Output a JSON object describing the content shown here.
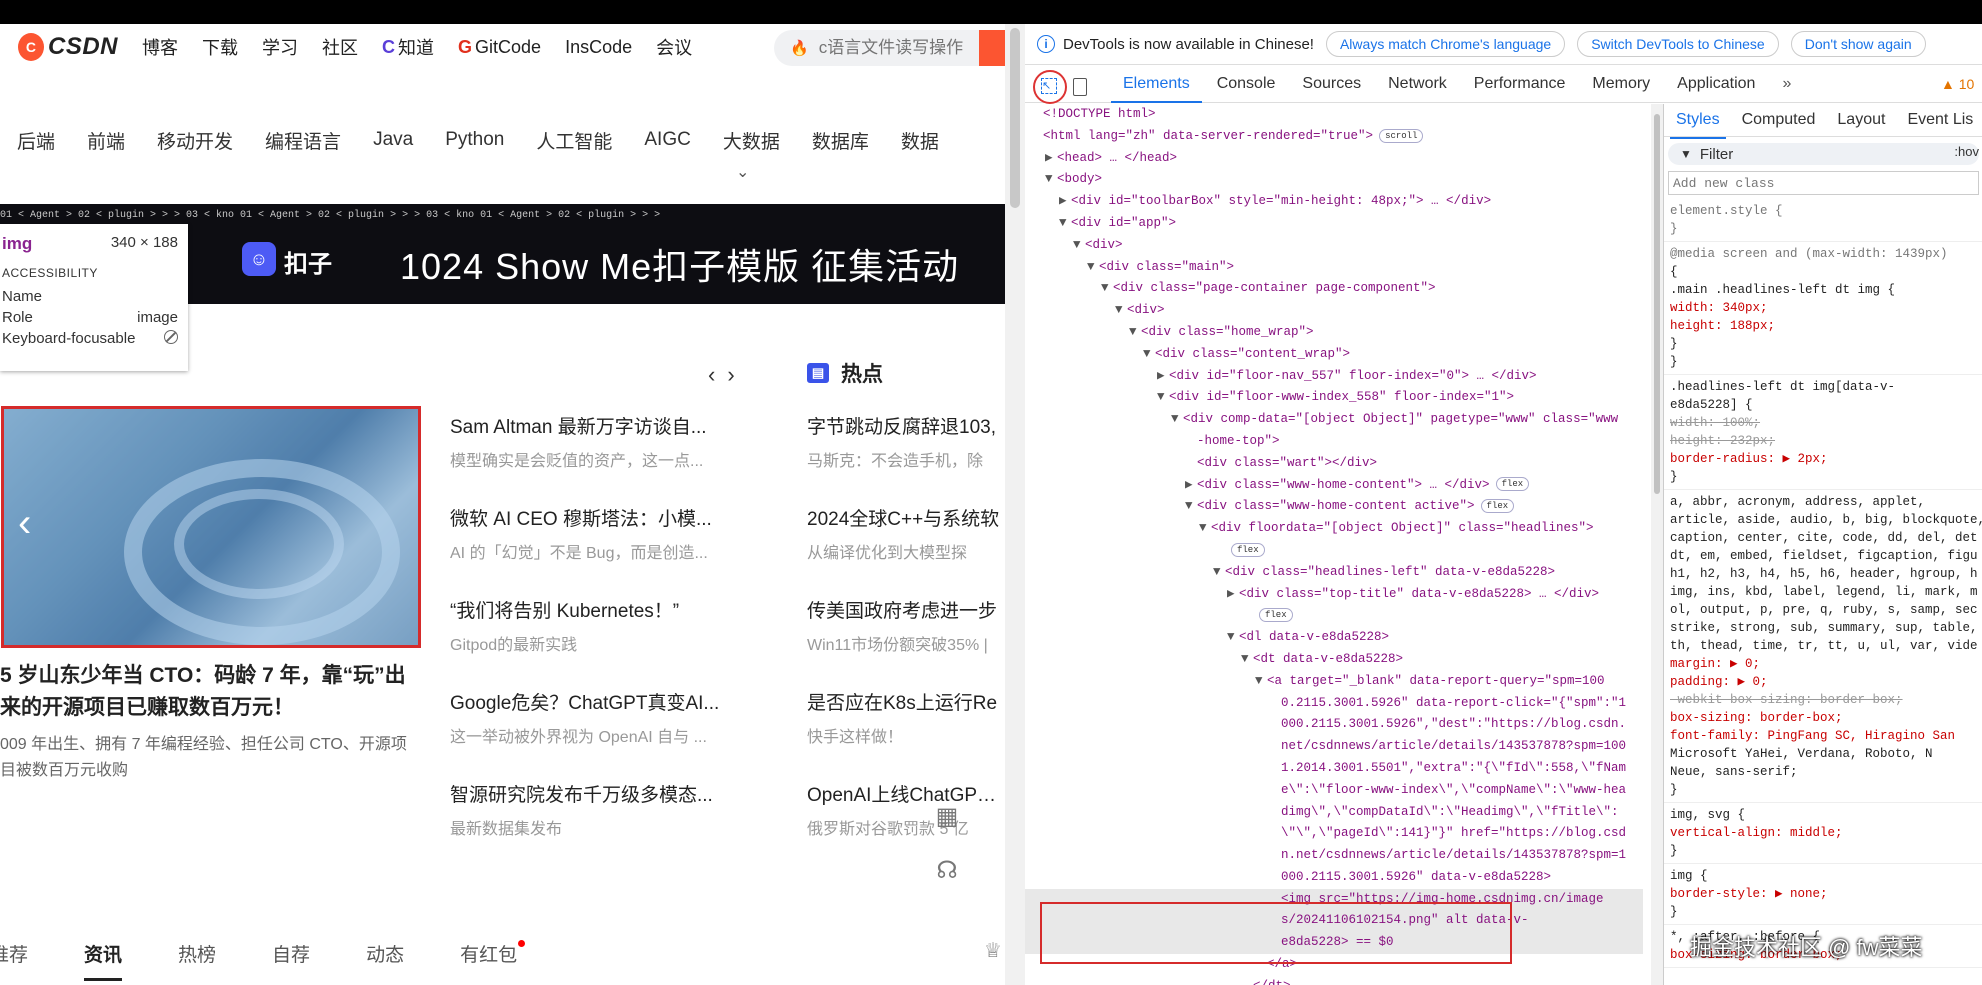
{
  "csdn": {
    "logo": "CSDN",
    "nav": [
      "博客",
      "下载",
      "学习",
      "社区",
      "知道",
      "GitCode",
      "InsCode",
      "会议"
    ],
    "search_placeholder": "c语言文件读写操作",
    "categories": [
      "后端",
      "前端",
      "移动开发",
      "编程语言",
      "Java",
      "Python",
      "人工智能",
      "AIGC",
      "大数据",
      "数据库",
      "数据"
    ],
    "banner": {
      "strip": "01 < Agent >     02 < plugin >     > >     03 < kno  01 < Agent >     02 < plugin >     > >     03 < kno  01 < Agent >     02 < plugin >     > >",
      "brand": "扣子",
      "title": "1024 Show Me扣子模版 征集活动"
    },
    "tooltip": {
      "tag": "img",
      "size": "340 × 188",
      "section": "ACCESSIBILITY",
      "rows": [
        {
          "label": "Name",
          "value": ""
        },
        {
          "label": "Role",
          "value": "image"
        },
        {
          "label": "Keyboard-focusable",
          "value": ""
        }
      ]
    },
    "hot_title": "热点",
    "feature": {
      "title": "5 岁山东少年当 CTO：码龄 7 年，靠“玩”出来的开源项目已赚取数百万元！",
      "desc": "009 年出生、拥有 7 年编程经验、担任公司 CTO、开源项目被数百万元收购"
    },
    "news_mid": [
      {
        "title": "Sam Altman 最新万字访谈自...",
        "sub": "模型确实是会贬值的资产，这一点..."
      },
      {
        "title": "微软 AI CEO 穆斯塔法：小模...",
        "sub": "AI 的「幻觉」不是 Bug，而是创造..."
      },
      {
        "title": "“我们将告别 Kubernetes！”",
        "sub": "Gitpod的最新实践"
      },
      {
        "title": "Google危矣？ChatGPT真变AI...",
        "sub": "这一举动被外界视为 OpenAI 自与 ..."
      },
      {
        "title": "智源研究院发布千万级多模态...",
        "sub": "最新数据集发布"
      }
    ],
    "news_hot": [
      {
        "title": "字节跳动反腐辞退103,",
        "sub": "马斯克：不会造手机，除"
      },
      {
        "title": "2024全球C++与系统软",
        "sub": "从编译优化到大模型探"
      },
      {
        "title": "传美国政府考虑进一步",
        "sub": "Win11市场份额突破35% |"
      },
      {
        "title": "是否应在K8s上运行Re",
        "sub": "快手这样做！"
      },
      {
        "title": "OpenAI上线ChatGPT打",
        "sub": "俄罗斯对谷歌罚款 5 亿"
      }
    ],
    "bottom_tabs": [
      "推荐",
      "资讯",
      "热榜",
      "自荐",
      "动态",
      "有红包"
    ]
  },
  "devtools": {
    "info": "DevTools is now available in Chinese!",
    "info_buttons": [
      "Always match Chrome's language",
      "Switch DevTools to Chinese",
      "Don't show again"
    ],
    "tabs": [
      "Elements",
      "Console",
      "Sources",
      "Network",
      "Performance",
      "Memory",
      "Application"
    ],
    "more": "»",
    "warnings": "▲ 10",
    "styles_tabs": [
      "Styles",
      "Computed",
      "Layout",
      "Event Lis"
    ],
    "filter_placeholder": "Filter",
    "hov": ":hov",
    "add_class_placeholder": "Add new class",
    "dom_lines": [
      {
        "indent": 0,
        "tri": "",
        "html": "<!DOCTYPE html>"
      },
      {
        "indent": 0,
        "tri": "",
        "html": "<html lang=\"zh\" data-server-rendered=\"true\">",
        "badge": "scroll"
      },
      {
        "indent": 1,
        "tri": "▶",
        "html": "<head> … </head>"
      },
      {
        "indent": 1,
        "tri": "▼",
        "html": "<body>"
      },
      {
        "indent": 2,
        "tri": "▶",
        "html": "<div id=\"toolbarBox\" style=\"min-height: 48px;\"> … </div>"
      },
      {
        "indent": 2,
        "tri": "▼",
        "html": "<div id=\"app\">"
      },
      {
        "indent": 3,
        "tri": "▼",
        "html": "<div>"
      },
      {
        "indent": 4,
        "tri": "▼",
        "html": "<div class=\"main\">"
      },
      {
        "indent": 5,
        "tri": "▼",
        "html": "<div class=\"page-container page-component\">"
      },
      {
        "indent": 6,
        "tri": "▼",
        "html": "<div>"
      },
      {
        "indent": 7,
        "tri": "▼",
        "html": "<div class=\"home_wrap\">"
      },
      {
        "indent": 8,
        "tri": "▼",
        "html": "<div class=\"content_wrap\">"
      },
      {
        "indent": 9,
        "tri": "▶",
        "html": "<div id=\"floor-nav_557\" floor-index=\"0\"> … </div>"
      },
      {
        "indent": 9,
        "tri": "▼",
        "html": "<div id=\"floor-www-index_558\" floor-index=\"1\">"
      },
      {
        "indent": 10,
        "tri": "▼",
        "html": "<div comp-data=\"[object Object]\" pagetype=\"www\" class=\"www"
      },
      {
        "indent": 11,
        "tri": "",
        "html": "-home-top\">"
      },
      {
        "indent": 11,
        "tri": "",
        "html": "<div class=\"wart\"></div>"
      },
      {
        "indent": 11,
        "tri": "▶",
        "html": "<div class=\"www-home-content\"> … </div>",
        "badge": "flex"
      },
      {
        "indent": 11,
        "tri": "▼",
        "html": "<div class=\"www-home-content active\">",
        "badge": "flex"
      },
      {
        "indent": 12,
        "tri": "▼",
        "html": "<div floordata=\"[object Object]\" class=\"headlines\">"
      },
      {
        "indent": 13,
        "tri": "",
        "html": "",
        "badge": "flex"
      },
      {
        "indent": 13,
        "tri": "▼",
        "html": "<div class=\"headlines-left\" data-v-e8da5228>"
      },
      {
        "indent": 14,
        "tri": "▶",
        "html": "<div class=\"top-title\" data-v-e8da5228> … </div>"
      },
      {
        "indent": 15,
        "tri": "",
        "html": "",
        "badge": "flex"
      },
      {
        "indent": 14,
        "tri": "▼",
        "html": "<dl data-v-e8da5228>"
      },
      {
        "indent": 15,
        "tri": "▼",
        "html": "<dt data-v-e8da5228>"
      },
      {
        "indent": 16,
        "tri": "▼",
        "html": "<a target=\"_blank\" data-report-query=\"spm=100"
      },
      {
        "indent": 17,
        "tri": "",
        "html": "0.2115.3001.5926\" data-report-click=\"{\"spm\":\"1"
      },
      {
        "indent": 17,
        "tri": "",
        "html": "000.2115.3001.5926\",\"dest\":\"https://blog.csdn."
      },
      {
        "indent": 17,
        "tri": "",
        "html": "net/csdnnews/article/details/143537878?spm=100"
      },
      {
        "indent": 17,
        "tri": "",
        "html": "1.2014.3001.5501\",\"extra\":\"{\\\"fId\\\":558,\\\"fNam"
      },
      {
        "indent": 17,
        "tri": "",
        "html": "e\\\":\\\"floor-www-index\\\",\\\"compName\\\":\\\"www-hea"
      },
      {
        "indent": 17,
        "tri": "",
        "html": "dimg\\\",\\\"compDataId\\\":\\\"Headimg\\\",\\\"fTitle\\\":"
      },
      {
        "indent": 17,
        "tri": "",
        "html": "\\\"\\\",\\\"pageId\\\":141}\"}\" href=\"https://blog.csd"
      },
      {
        "indent": 17,
        "tri": "",
        "html": "n.net/csdnnews/article/details/143537878?spm=1"
      },
      {
        "indent": 17,
        "tri": "",
        "html": "000.2115.3001.5926\" data-v-e8da5228>"
      },
      {
        "indent": 17,
        "tri": "",
        "html": "<img src=\"https://img-home.csdnimg.cn/image",
        "selected": true
      },
      {
        "indent": 17,
        "tri": "",
        "html": "s/20241106102154.png\" alt data-v-",
        "selected": true
      },
      {
        "indent": 17,
        "tri": "",
        "html": "e8da5228> == $0",
        "selected": true
      },
      {
        "indent": 16,
        "tri": "",
        "html": "</a>"
      },
      {
        "indent": 15,
        "tri": "",
        "html": "</dt>"
      }
    ],
    "style_rules": [
      [
        "element.style {",
        "}"
      ],
      [
        "@media screen and (max-width: 1439px)",
        "{",
        ".main .headlines-left dt img {",
        "  width: 340px;",
        "  height: 188px;",
        "}",
        "}"
      ],
      [
        ".headlines-left dt img[data-v-",
        "e8da5228] {",
        "  width: 100%;",
        "  height: 232px;",
        "  border-radius: ▶ 2px;",
        "}"
      ],
      [
        "a, abbr, acronym, address, applet,",
        "article, aside, audio, b, big, blockquote,",
        "caption, center, cite, code, dd, del, det",
        "dt, em, embed, fieldset, figcaption, figu",
        "h1, h2, h3, h4, h5, h6, header, hgroup, h",
        "img, ins, kbd, label, legend, li, mark, m",
        "ol, output, p, pre, q, ruby, s, samp, sec",
        "strike, strong, sub, summary, sup, table,",
        "th, thead, time, tr, tt, u, ul, var, vide",
        "  margin: ▶ 0;",
        "  padding: ▶ 0;",
        "  -webkit-box-sizing: border-box;",
        "  box-sizing: border-box;",
        "  font-family: PingFang SC, Hiragino San",
        "      Microsoft YaHei, Verdana, Roboto, N",
        "      Neue, sans-serif;",
        "}"
      ],
      [
        "img, svg {",
        "  vertical-align: middle;",
        "}"
      ],
      [
        "img {",
        "  border-style: ▶ none;",
        "}"
      ],
      [
        "*, :after, :before {",
        "  box-sizing: border-box;"
      ]
    ]
  },
  "watermark": "掘金技术社区 @ fw菜菜"
}
